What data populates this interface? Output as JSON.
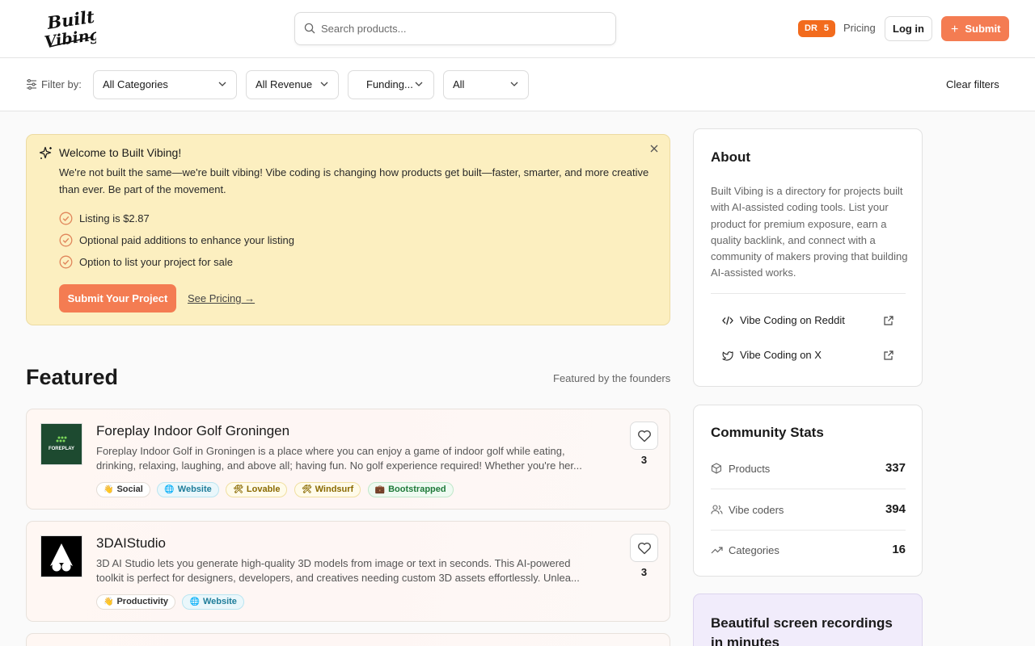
{
  "header": {
    "logo_text": "Built Vibing",
    "search_placeholder": "Search products...",
    "dr_label": "DR",
    "dr_value": "5",
    "pricing": "Pricing",
    "login": "Log in",
    "submit": "Submit",
    "accent_color": "#f47c52"
  },
  "filters": {
    "label": "Filter by:",
    "category": "All Categories",
    "revenue": "All Revenue",
    "funding": "Funding...",
    "all": "All",
    "clear": "Clear filters"
  },
  "welcome": {
    "title": "Welcome to Built Vibing!",
    "body": "We're not built the same—we're built vibing! Vibe coding is changing how products get built—faster, smarter, and more creative than ever. Be part of the movement.",
    "checks": [
      "Listing is $2.87",
      "Optional paid additions to enhance your listing",
      "Option to list your project for sale"
    ],
    "button": "Submit Your Project",
    "link": "See Pricing →"
  },
  "featured": {
    "title": "Featured",
    "subtitle": "Featured by the founders",
    "products": [
      {
        "name": "Foreplay Indoor Golf Groningen",
        "thumb_text": "FOREPLAY",
        "description": "Foreplay Indoor Golf in Groningen is a place where you can enjoy a game of indoor golf while eating, drinking, relaxing, laughing, and above all; having fun. No golf experience required! Whether you're her...",
        "tags": [
          "Social",
          "Website",
          "Lovable",
          "Windsurf",
          "Bootstrapped"
        ],
        "likes": "3"
      },
      {
        "name": "3DAIStudio",
        "description": "3D AI Studio lets you generate high-quality 3D models from image or text in seconds. This AI-powered toolkit is perfect for designers, developers, and creatives needing custom 3D assets effortlessly. Unlea...",
        "tags": [
          "Productivity",
          "Website"
        ],
        "likes": "3"
      }
    ]
  },
  "about": {
    "title": "About",
    "text": "Built Vibing is a directory for projects built with AI-assisted coding tools. List your product for premium exposure, earn a quality backlink, and connect with a community of makers proving that building AI-assisted works.",
    "links": [
      "Vibe Coding on Reddit",
      "Vibe Coding on X"
    ]
  },
  "stats": {
    "title": "Community Stats",
    "items": [
      {
        "label": "Products",
        "value": "337"
      },
      {
        "label": "Vibe coders",
        "value": "394"
      },
      {
        "label": "Categories",
        "value": "16"
      }
    ]
  },
  "promo": {
    "text": "Beautiful screen recordings in minutes"
  }
}
